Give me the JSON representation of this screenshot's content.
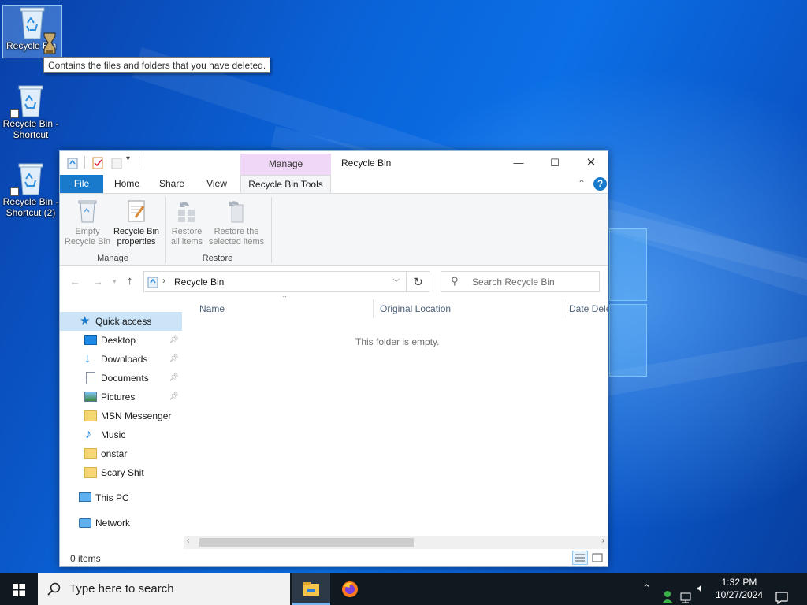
{
  "desktop": {
    "icons": [
      {
        "label": "Recycle Bin",
        "shortcut": false
      },
      {
        "label": "Recycle Bin - Shortcut",
        "shortcut": true
      },
      {
        "label": "Recycle Bin - Shortcut (2)",
        "shortcut": true
      }
    ],
    "tooltip": "Contains the files and folders that you have deleted."
  },
  "window": {
    "title": "Recycle Bin",
    "context_tab_group": "Manage",
    "tabs": [
      "File",
      "Home",
      "Share",
      "View",
      "Recycle Bin Tools"
    ],
    "ribbon": {
      "manage_group": {
        "label": "Manage",
        "empty_label": "Empty Recycle Bin",
        "properties_label": "Recycle Bin properties"
      },
      "restore_group": {
        "label": "Restore",
        "restore_all_label": "Restore all items",
        "restore_selected_label": "Restore the selected items"
      }
    },
    "address": {
      "path": "Recycle Bin",
      "separator": "›"
    },
    "search": {
      "placeholder": "Search Recycle Bin"
    },
    "nav_pane": {
      "quick_access": "Quick access",
      "items": [
        {
          "label": "Desktop",
          "pinned": true,
          "icon": "desktop-icon"
        },
        {
          "label": "Downloads",
          "pinned": true,
          "icon": "download-icon"
        },
        {
          "label": "Documents",
          "pinned": true,
          "icon": "document-icon"
        },
        {
          "label": "Pictures",
          "pinned": true,
          "icon": "picture-icon"
        },
        {
          "label": "MSN Messenger",
          "pinned": false,
          "icon": "folder-icon"
        },
        {
          "label": "Music",
          "pinned": false,
          "icon": "music-icon"
        },
        {
          "label": "onstar",
          "pinned": false,
          "icon": "folder-icon"
        },
        {
          "label": "Scary Shit",
          "pinned": false,
          "icon": "folder-icon"
        }
      ],
      "this_pc": "This PC",
      "network": "Network"
    },
    "columns": [
      "Name",
      "Original Location",
      "Date Dele"
    ],
    "empty_message": "This folder is empty.",
    "status": "0 items"
  },
  "taskbar": {
    "search_placeholder": "Type here to search",
    "time": "1:32 PM",
    "date": "10/27/2024"
  },
  "colors": {
    "accent": "#1979ca",
    "context_tab": "#f0d6f7",
    "selection": "#cce4f7"
  }
}
